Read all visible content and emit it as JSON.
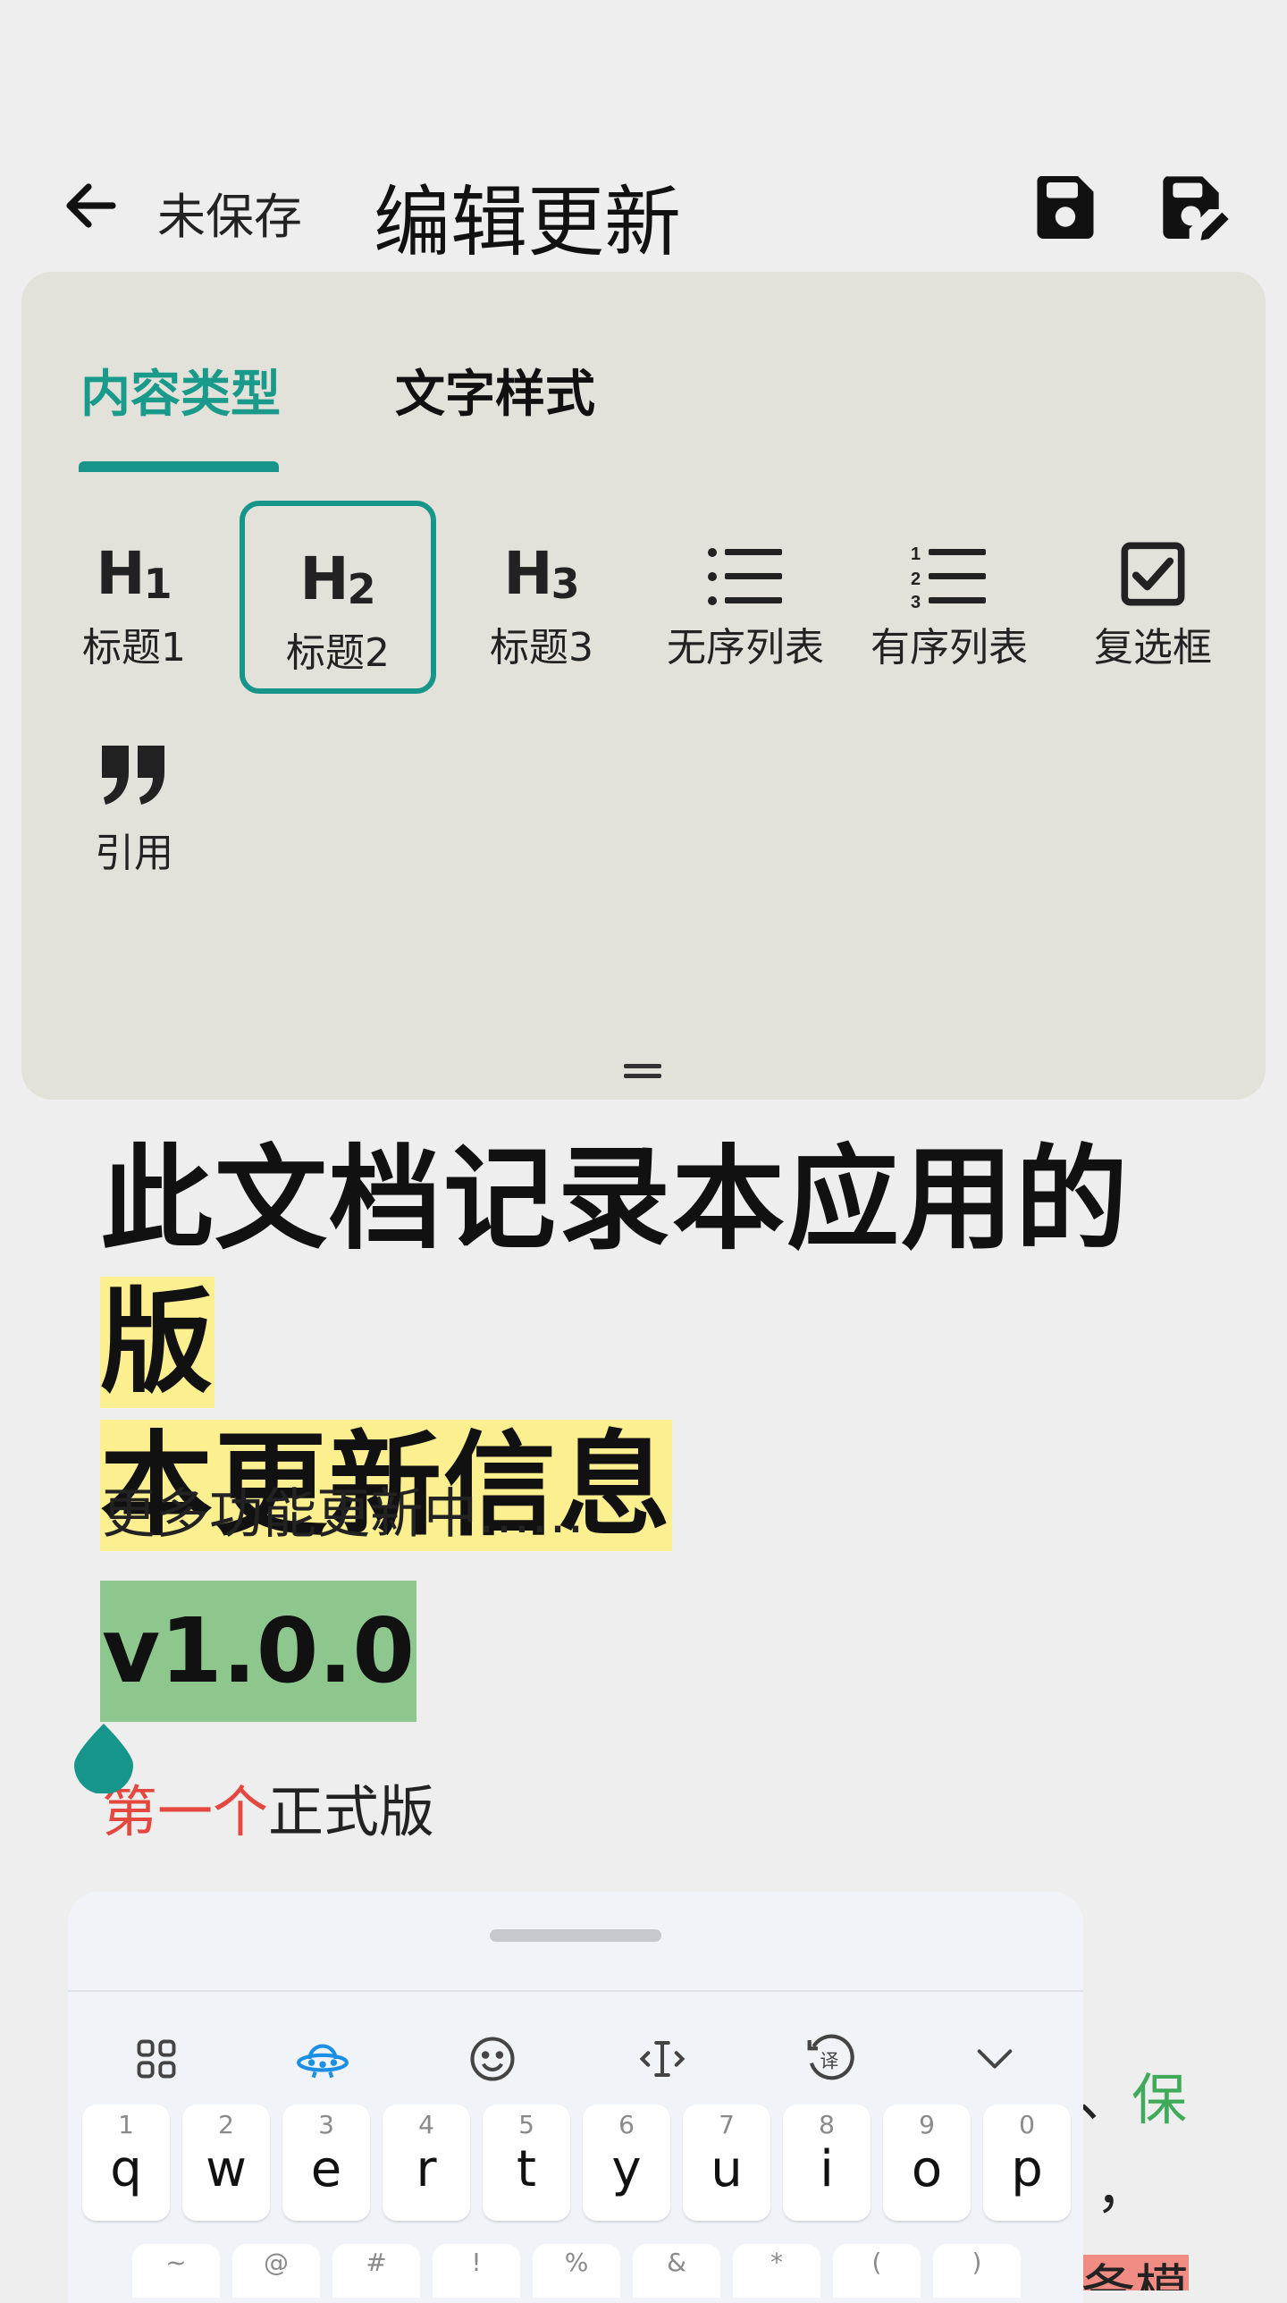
{
  "header": {
    "back_icon": "arrow-left-icon",
    "unsaved_label": "未保存",
    "title": "编辑更新",
    "save_icon": "save-icon",
    "save_as_icon": "save-edit-icon"
  },
  "panel": {
    "tabs": [
      {
        "label": "内容类型",
        "active": true
      },
      {
        "label": "文字样式",
        "active": false
      }
    ],
    "formats": [
      {
        "icon_text": "H",
        "icon_sub": "1",
        "label": "标题1",
        "selected": false
      },
      {
        "icon_text": "H",
        "icon_sub": "2",
        "label": "标题2",
        "selected": true
      },
      {
        "icon_text": "H",
        "icon_sub": "3",
        "label": "标题3",
        "selected": false
      },
      {
        "icon": "bullet-list-icon",
        "label": "无序列表",
        "selected": false
      },
      {
        "icon": "numbered-list-icon",
        "label": "有序列表",
        "selected": false
      },
      {
        "icon": "checkbox-icon",
        "label": "复选框",
        "selected": false
      },
      {
        "icon": "quote-icon",
        "label": "引用",
        "selected": false
      }
    ],
    "accent_color": "#17958a"
  },
  "document": {
    "title_part1": "此文档记录本应用的",
    "title_highlight_1": "版",
    "title_highlight_2": "本更新信息",
    "subtitle": "更多功能更新中……",
    "version": "v1.0.0",
    "version_highlight_color": "#8ec78d",
    "first_red": "第一个",
    "first_rest": "正式版",
    "right_fragment_dash": "、",
    "right_fragment_green": "保",
    "right_fragment_comma": "，",
    "right_fragment_red": "备模"
  },
  "keyboard": {
    "toolbar_icons": [
      "apps-grid-icon",
      "ufo-icon",
      "emoji-icon",
      "cursor-icon",
      "translate-icon",
      "collapse-chevron-icon"
    ],
    "row1": [
      {
        "num": "1",
        "ch": "q"
      },
      {
        "num": "2",
        "ch": "w"
      },
      {
        "num": "3",
        "ch": "e"
      },
      {
        "num": "4",
        "ch": "r"
      },
      {
        "num": "5",
        "ch": "t"
      },
      {
        "num": "6",
        "ch": "y"
      },
      {
        "num": "7",
        "ch": "u"
      },
      {
        "num": "8",
        "ch": "i"
      },
      {
        "num": "9",
        "ch": "o"
      },
      {
        "num": "0",
        "ch": "p"
      }
    ],
    "row2_symbols": [
      "~",
      "@",
      "#",
      "!",
      "%",
      "&",
      "*",
      "(",
      ")"
    ]
  }
}
